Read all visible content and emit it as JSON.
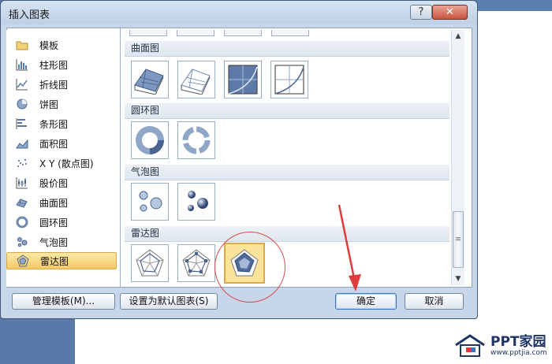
{
  "dialog": {
    "title": "插入图表",
    "help_label": "?",
    "close_label": "✕"
  },
  "categories": [
    {
      "label": "模板",
      "icon": "folder-icon"
    },
    {
      "label": "柱形图",
      "icon": "column-chart-icon"
    },
    {
      "label": "折线图",
      "icon": "line-chart-icon"
    },
    {
      "label": "饼图",
      "icon": "pie-chart-icon"
    },
    {
      "label": "条形图",
      "icon": "bar-chart-icon"
    },
    {
      "label": "面积图",
      "icon": "area-chart-icon"
    },
    {
      "label": "X Y (散点图)",
      "icon": "scatter-chart-icon"
    },
    {
      "label": "股价图",
      "icon": "stock-chart-icon"
    },
    {
      "label": "曲面图",
      "icon": "surface-chart-icon"
    },
    {
      "label": "圆环图",
      "icon": "doughnut-chart-icon"
    },
    {
      "label": "气泡图",
      "icon": "bubble-chart-icon"
    },
    {
      "label": "雷达图",
      "icon": "radar-chart-icon",
      "selected": true
    }
  ],
  "sections": {
    "surface": "曲面图",
    "doughnut": "圆环图",
    "bubble": "气泡图",
    "radar": "雷达图"
  },
  "buttons": {
    "manage_templates": "管理模板(M)...",
    "set_default": "设置为默认图表(S)",
    "ok": "确定",
    "cancel": "取消"
  },
  "scrollbar": {
    "up": "▲",
    "down": "▼",
    "grip": "≡"
  },
  "watermark": {
    "main": "PPT家园",
    "sub": "www.pptjia.com"
  },
  "colors": {
    "selection": "#f6c965",
    "accent": "#3a75c1",
    "annotation": "#d94a4a"
  }
}
